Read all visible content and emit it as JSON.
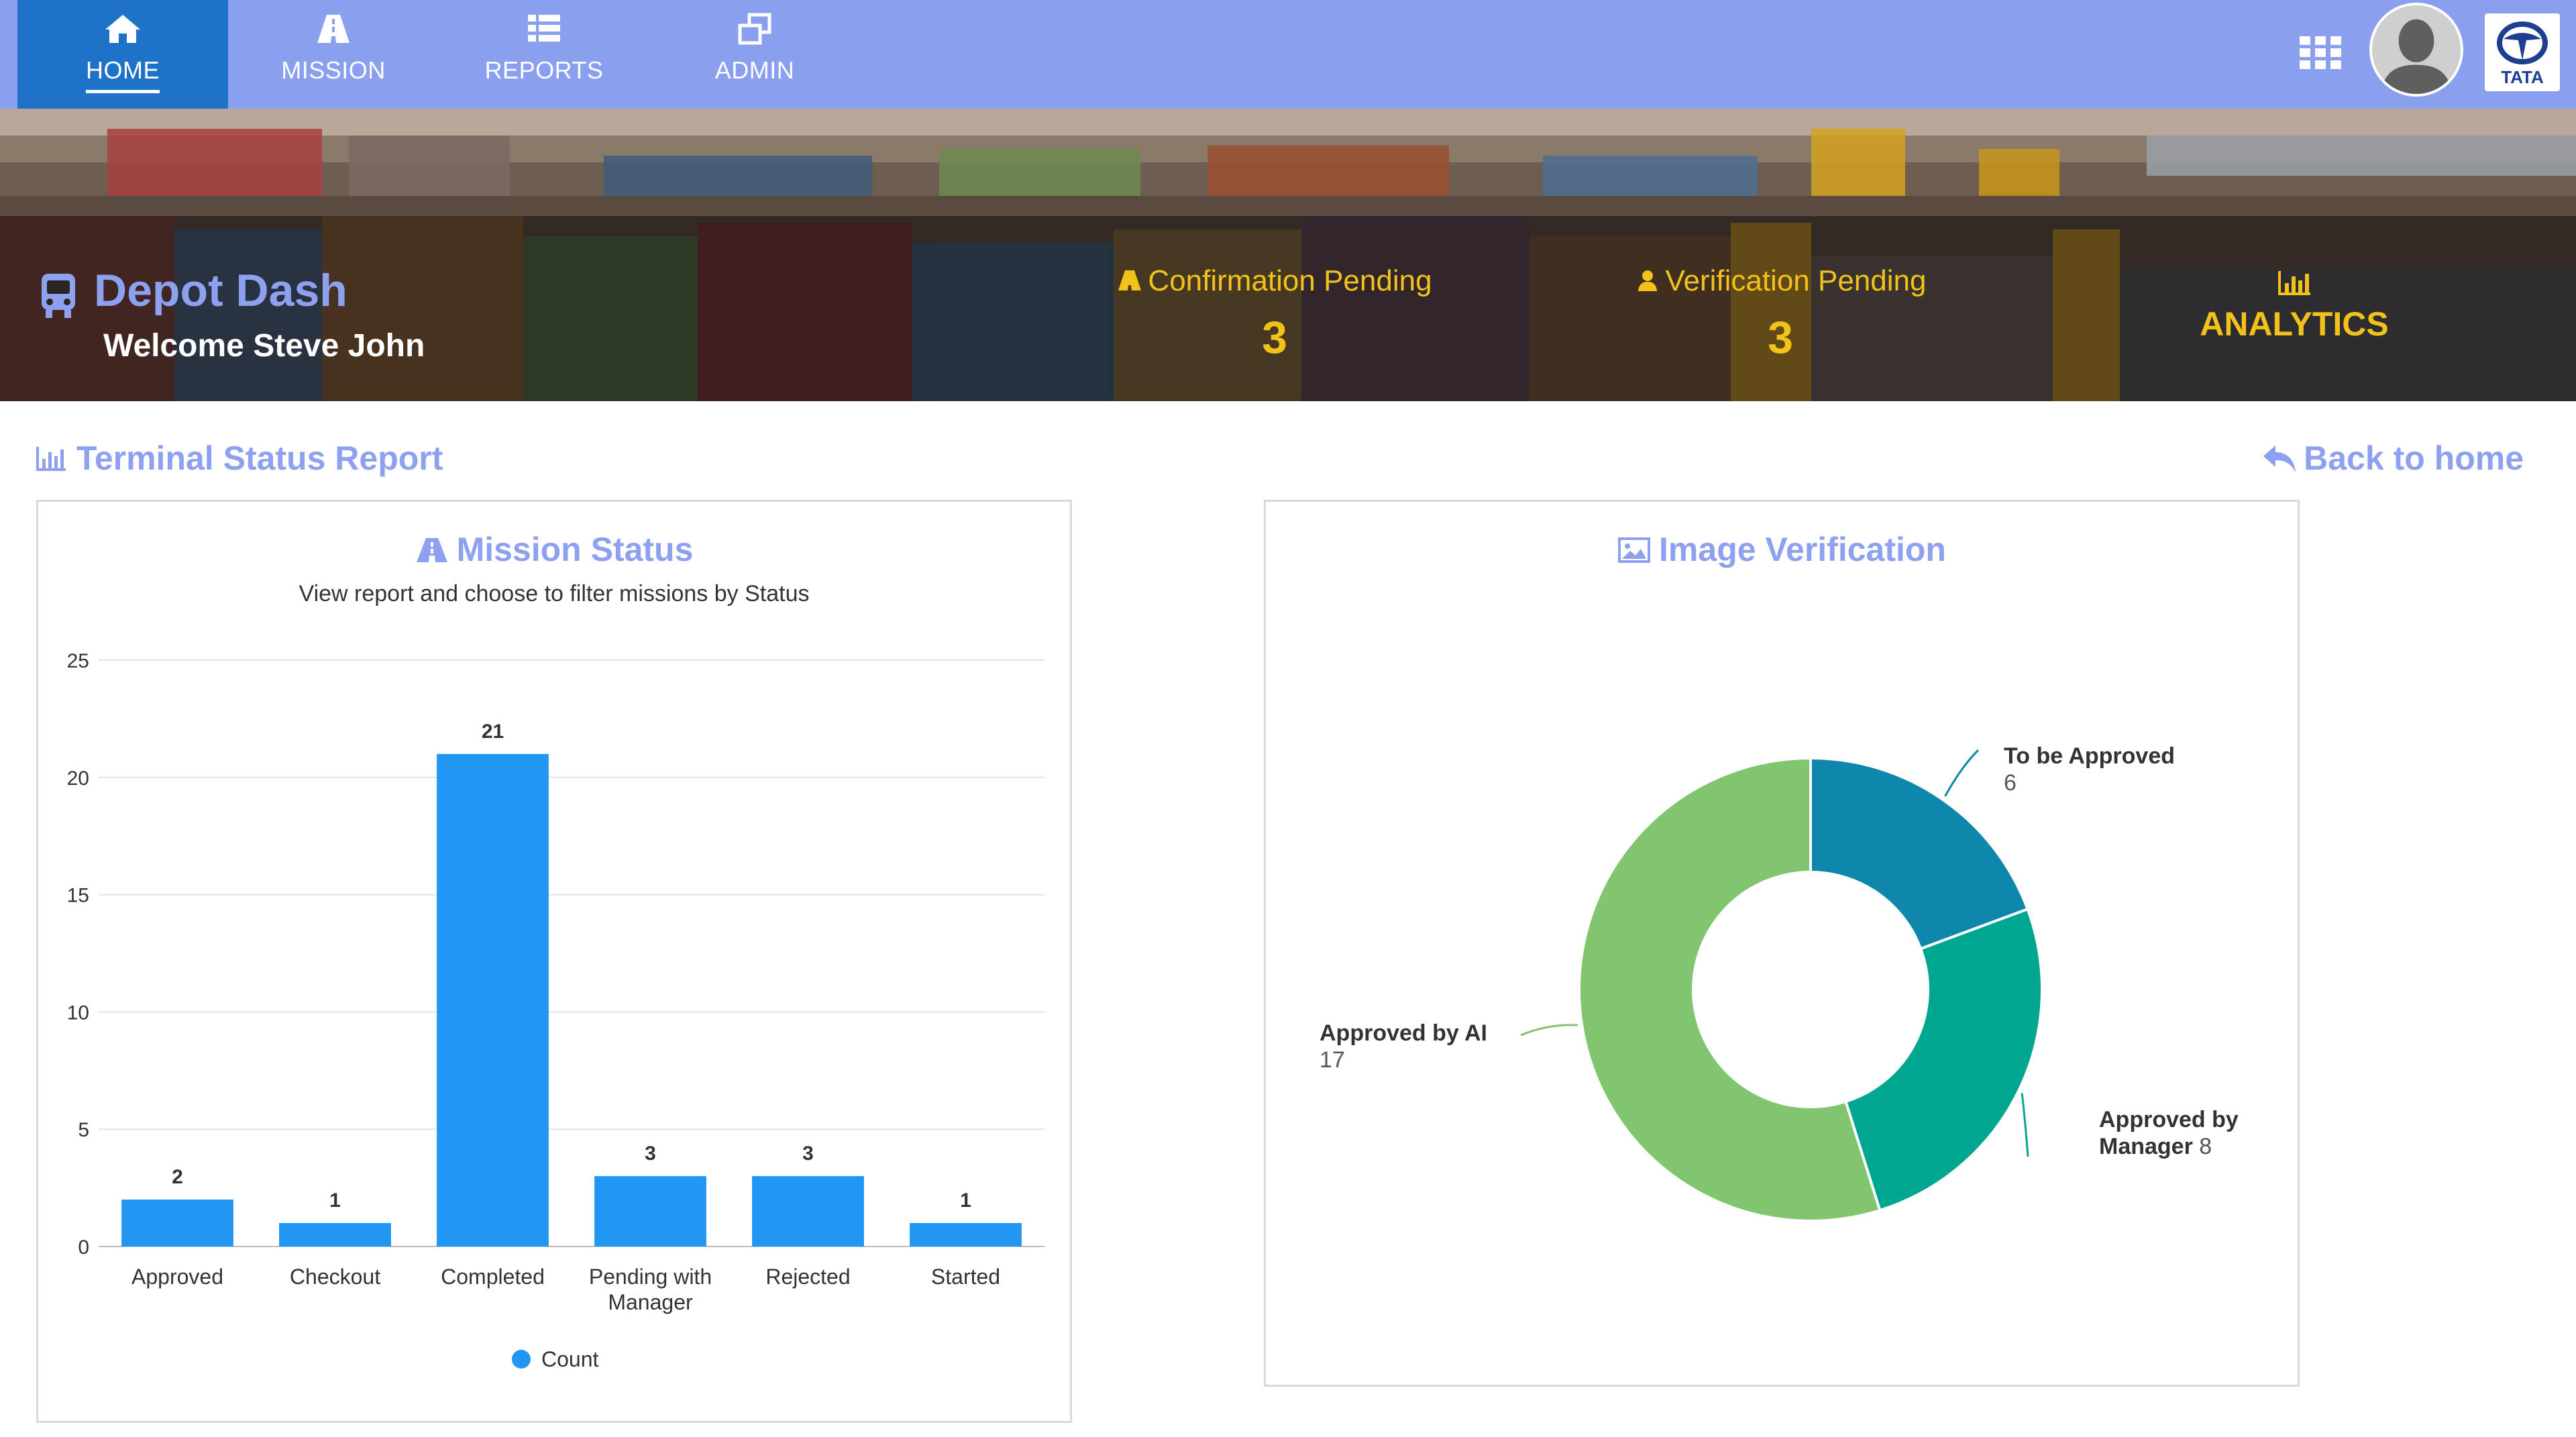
{
  "nav": {
    "items": [
      {
        "label": "HOME",
        "icon": "home-icon",
        "active": true
      },
      {
        "label": "MISSION",
        "icon": "road-icon",
        "active": false
      },
      {
        "label": "REPORTS",
        "icon": "list-icon",
        "active": false
      },
      {
        "label": "ADMIN",
        "icon": "window-restore-icon",
        "active": false
      }
    ],
    "apps_icon": "grid-apps-icon",
    "avatar_icon": "user-avatar",
    "logo_text": "TATA"
  },
  "banner": {
    "title": "Depot Dash",
    "welcome": "Welcome Steve John",
    "stats": [
      {
        "label": "Confirmation Pending",
        "value": "3",
        "icon": "road-icon"
      },
      {
        "label": "Verification Pending",
        "value": "3",
        "icon": "user-icon"
      }
    ],
    "analytics_label": "ANALYTICS"
  },
  "section": {
    "title": "Terminal Status Report",
    "back_label": "Back to home"
  },
  "mission_panel": {
    "title": "Mission Status",
    "subtitle": "View report and choose to filter missions by Status"
  },
  "image_panel": {
    "title": "Image Verification"
  },
  "colors": {
    "nav_bg": "#8aa0ee",
    "nav_active": "#1e73c8",
    "accent_text": "#8ea1f0",
    "highlight": "#f3c21a",
    "bar": "#2196f3",
    "pie": [
      "#0f86ab",
      "#00a690",
      "#82c56f"
    ]
  },
  "chart_data": [
    {
      "type": "bar",
      "title": "Mission Status",
      "subtitle": "View report and choose to filter missions by Status",
      "categories": [
        "Approved",
        "Checkout",
        "Completed",
        "Pending with Manager",
        "Rejected",
        "Started"
      ],
      "category_lines": [
        [
          "Approved"
        ],
        [
          "Checkout"
        ],
        [
          "Completed"
        ],
        [
          "Pending with",
          "Manager"
        ],
        [
          "Rejected"
        ],
        [
          "Started"
        ]
      ],
      "series": [
        {
          "name": "Count",
          "values": [
            2,
            1,
            21,
            3,
            3,
            1
          ]
        }
      ],
      "yticks": [
        0,
        5,
        10,
        15,
        20,
        25
      ],
      "ylim": [
        0,
        25
      ],
      "grid": true,
      "legend": "bottom-center"
    },
    {
      "type": "pie",
      "title": "Image Verification",
      "donut": true,
      "slices": [
        {
          "label": "To be Approved",
          "label_lines": [
            "To be Approved"
          ],
          "value": 6
        },
        {
          "label": "Approved by Manager",
          "label_lines": [
            "Approved by",
            "Manager"
          ],
          "value": 8
        },
        {
          "label": "Approved by AI",
          "label_lines": [
            "Approved by AI"
          ],
          "value": 17
        }
      ]
    }
  ]
}
